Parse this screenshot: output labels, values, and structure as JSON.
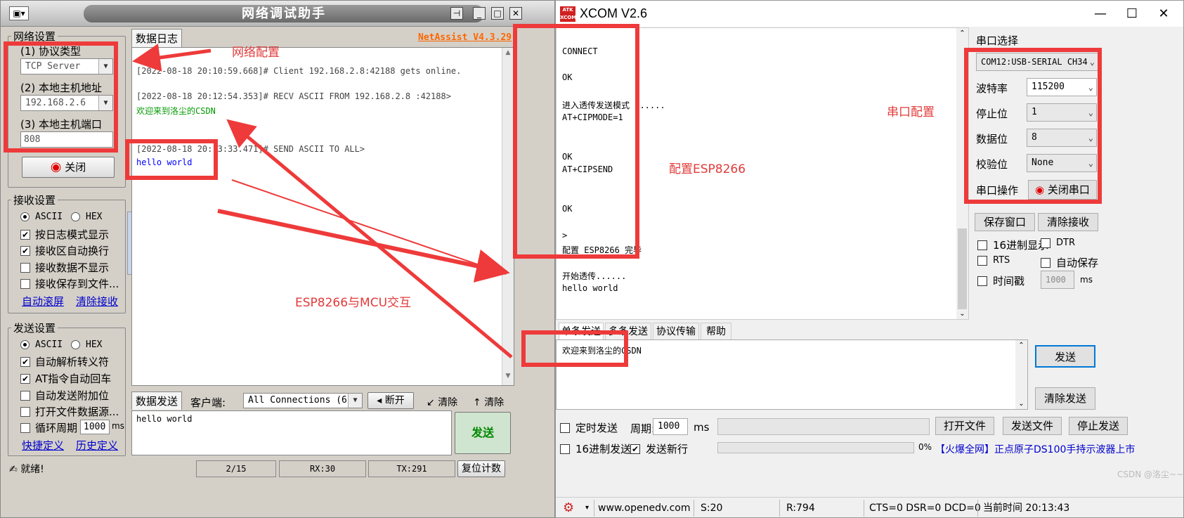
{
  "netassist": {
    "title": "网络调试助手",
    "version": "NetAssist V4.3.29",
    "network": {
      "group_label": "网络设置",
      "protocol_label": "(1) 协议类型",
      "protocol_value": "TCP Server",
      "host_label": "(2) 本地主机地址",
      "host_value": "192.168.2.6",
      "port_label": "(3) 本地主机端口",
      "port_value": "808",
      "close_button": "关闭"
    },
    "receive": {
      "group_label": "接收设置",
      "ascii": "ASCII",
      "hex": "HEX",
      "options": [
        "按日志模式显示",
        "接收区自动换行",
        "接收数据不显示",
        "接收保存到文件..."
      ],
      "links": [
        "自动滚屏",
        "清除接收"
      ]
    },
    "send": {
      "group_label": "发送设置",
      "ascii": "ASCII",
      "hex": "HEX",
      "options": [
        "自动解析转义符",
        "AT指令自动回车",
        "自动发送附加位",
        "打开文件数据源..."
      ],
      "cycle_label": "循环周期",
      "cycle_value": "1000",
      "cycle_unit": "ms",
      "links": [
        "快捷定义",
        "历史定义"
      ]
    },
    "log": {
      "tab": "数据日志",
      "lines": [
        "[2022-08-18 20:10:59.668]# Client 192.168.2.8:42188 gets online.",
        "[2022-08-18 20:12:54.353]# RECV ASCII FROM 192.168.2.8 :42188>",
        "欢迎来到洛尘的CSDN",
        "[2022-08-18 20:13:33.471]# SEND ASCII TO ALL>",
        "hello world"
      ]
    },
    "sendbar": {
      "tab": "数据发送",
      "client_label": "客户端:",
      "client_value": "All Connections (6)",
      "disconnect": "断开",
      "clear1": "清除",
      "clear2": "清除",
      "send_text": "hello world",
      "send_button": "发送"
    },
    "status": {
      "ready": "就绪!",
      "count": "2/15",
      "rx": "RX:30",
      "tx": "TX:291",
      "reset": "复位计数"
    }
  },
  "xcom": {
    "title": "XCOM V2.6",
    "logo": "ATK XCOM",
    "receive_lines": [
      "CONNECT",
      "",
      "OK",
      "",
      "进入透传发送模式 ......",
      "AT+CIPMODE=1",
      "",
      "",
      "OK",
      "AT+CIPSEND",
      "",
      "",
      "OK",
      "",
      ">",
      "配置 ESP8266 完毕",
      "",
      "开始透传......",
      "hello world"
    ],
    "panel": {
      "port_select_label": "串口选择",
      "port_value": "COM12:USB-SERIAL CH34",
      "baud_label": "波特率",
      "baud_value": "115200",
      "stop_label": "停止位",
      "stop_value": "1",
      "data_label": "数据位",
      "data_value": "8",
      "parity_label": "校验位",
      "parity_value": "None",
      "op_label": "串口操作",
      "op_button": "关闭串口",
      "save_window": "保存窗口",
      "clear_receive": "清除接收",
      "hex_display": "16进制显示",
      "dtr": "DTR",
      "rts": "RTS",
      "auto_save": "自动保存",
      "timestamp": "时间戳",
      "timestamp_value": "1000",
      "ms": "ms"
    },
    "tabs": [
      "单条发送",
      "多条发送",
      "协议传输",
      "帮助"
    ],
    "send_text": "欢迎来到洛尘的CSDN",
    "send_button": "发送",
    "clear_send_button": "清除发送",
    "timed_send": "定时发送",
    "period_label": "周期:",
    "period_value": "1000",
    "period_unit": "ms",
    "open_file": "打开文件",
    "send_file": "发送文件",
    "stop_send": "停止发送",
    "hex_send": "16进制发送",
    "send_newline": "发送新行",
    "progress_text": "0%",
    "progress": 0,
    "ad_text": "【火爆全网】正点原子DS100手持示波器上市",
    "status": {
      "url": "www.openedv.com",
      "s": "S:20",
      "r": "R:794",
      "lines": "CTS=0 DSR=0 DCD=0",
      "time": "当前时间 20:13:43"
    }
  },
  "annotations": {
    "net_config": "网络配置",
    "serial_config": "串口配置",
    "esp_config": "配置ESP8266",
    "esp_mcu": "ESP8266与MCU交互"
  },
  "watermark": "CSDN @洛尘~~",
  "colors": {
    "annotation_red": "#ee3a3a",
    "log_green": "#009900",
    "log_blue": "#0000ff",
    "version_orange": "#ff6600"
  }
}
